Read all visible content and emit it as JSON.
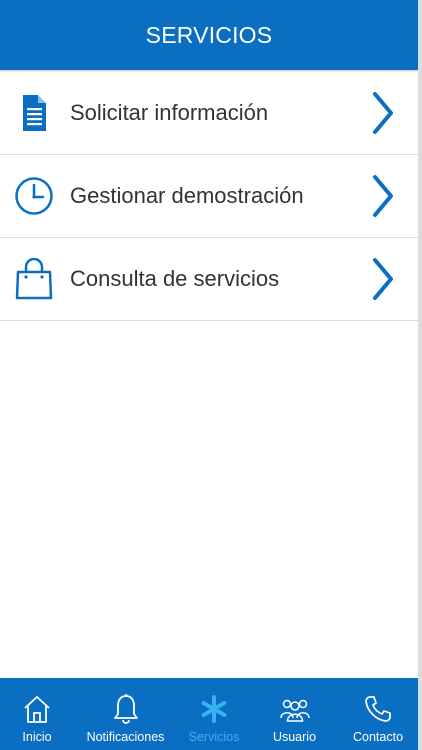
{
  "header": {
    "title": "SERVICIOS"
  },
  "services": [
    {
      "label": "Solicitar información",
      "icon": "document-icon"
    },
    {
      "label": "Gestionar demostración",
      "icon": "clock-icon"
    },
    {
      "label": "Consulta de servicios",
      "icon": "shopping-bag-icon"
    }
  ],
  "tabbar": {
    "active": "Servicios",
    "items": [
      {
        "label": "Inicio",
        "icon": "home-icon"
      },
      {
        "label": "Notificaciones",
        "icon": "bell-icon"
      },
      {
        "label": "Servicios",
        "icon": "asterisk-icon"
      },
      {
        "label": "Usuario",
        "icon": "users-icon"
      },
      {
        "label": "Contacto",
        "icon": "phone-icon"
      }
    ]
  },
  "colors": {
    "primary": "#0a6fc2",
    "active_tab": "#39b0f0",
    "row_text": "#333333"
  }
}
